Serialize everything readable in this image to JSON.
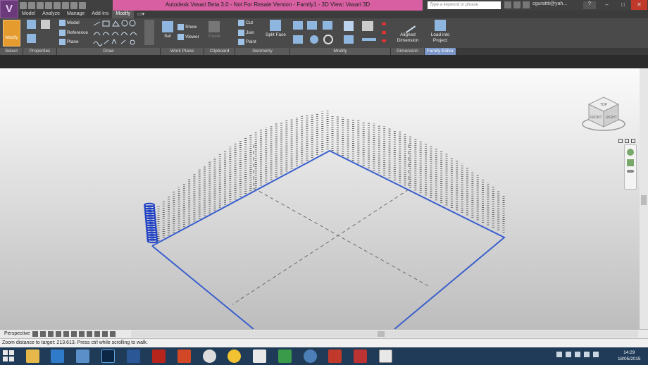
{
  "app": {
    "title": "Autodesk Vasari Beta 3.0 - Not For Resale Version -     Family1 - 3D View: Vasari 3D",
    "search_placeholder": "Type a keyword or phrase",
    "user": "cgurattti@yah...",
    "app_letter": "V"
  },
  "tabs": [
    "Model",
    "Analyze",
    "Manage",
    "Add-Ins",
    "Modify"
  ],
  "ribbon": {
    "modify": "Modify",
    "model": "Model",
    "reference": "Reference",
    "plane": "Plane",
    "set": "Set",
    "show": "Show",
    "viewer": "Viewer",
    "paste": "Paste",
    "cut": "Cut",
    "join": "Join",
    "paint": "Paint",
    "split_face": "Split Face",
    "aligned_dimension": "Aligned Dimension",
    "load_into_project": "Load into Project"
  },
  "panels": [
    "Select",
    "Properties",
    "Draw",
    "Work Plane",
    "Clipboard",
    "Geometry",
    "Modify",
    "Dimension",
    "Family Editor"
  ],
  "viewport": {
    "view_type": "Perspective"
  },
  "viewcube": {
    "top": "TOP",
    "front": "FRONT",
    "right": "RIGHT"
  },
  "status": "Zoom distance to target: 213.613. Press ctrl while scrolling to walk.",
  "clock": {
    "time": "14:29",
    "date": "18/05/2015"
  },
  "colors": {
    "accent": "#e59b2d",
    "title_pink": "#d75fa2",
    "model_line": "#3a5fcd",
    "family_editor": "#7b97c9"
  }
}
